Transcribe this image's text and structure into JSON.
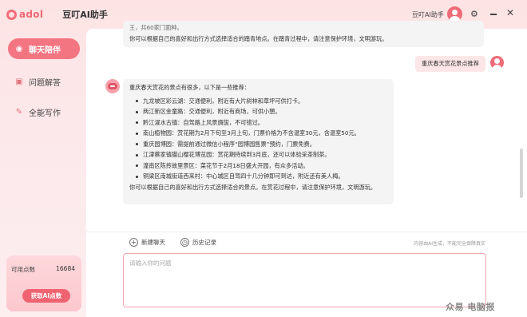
{
  "header": {
    "logo_text": "adol",
    "app_title": "豆叮AI助手",
    "user_name": "豆叮AI助手"
  },
  "sidebar": {
    "items": [
      {
        "label": "聊天陪伴",
        "icon": "chat-bubble-icon",
        "active": true
      },
      {
        "label": "问题解答",
        "icon": "question-box-icon",
        "active": false
      },
      {
        "label": "全能写作",
        "icon": "pencil-icon",
        "active": false
      }
    ],
    "points": {
      "label": "可用点数",
      "value": "16684",
      "button_label": "获取AI点数"
    }
  },
  "chat": {
    "previous_bot": {
      "truncated_text": "王，共60家门面种。",
      "closing": "你可以根据自己的喜好和出行方式选择适合的踏青地点。在踏青过程中，请注意保护环境，文明游玩。"
    },
    "user_message": "重庆春天赏花景点推荐",
    "bot_reply": {
      "intro": "重庆春天赏花的景点有很多，以下是一些推荐：",
      "items": [
        "九龙坡区彩云湖：交通便利，附近有大片树林和草坪可供打卡。",
        "两江新区金童路：交通便利，附近有商场，可供小憩。",
        "黔江濯水古镇：自驾路上风景旖旎，不可错过。",
        "南山植物园：赏花期为2月下旬至3月上旬，门票价格为不含温室30元，含温室50元。",
        "重庆园博园：需提前通过微信小程序“园博园售票”预约，门票免费。",
        "江津蔡家镇猫山樱花博览园：赏花期持续到3月底，还可以体验采茶制茶。",
        "潼南区陈抟故里景区：菜花节于2月18日盛大开园，有众多活动。",
        "铜梁区南城街道西来村：中心城区自驾四十几分钟即可到达，附近还有美人梅。"
      ],
      "closing": "你可以根据自己的喜好和出行方式选择适合的景点。在赏花过程中，请注意保护环境，文明游玩。"
    }
  },
  "toolbar": {
    "new_chat_label": "新建聊天",
    "history_label": "历史记录",
    "disclaimer": "内容由AI生成，不能完全保障真实"
  },
  "input": {
    "placeholder": "请输入你的问题",
    "value": ""
  },
  "watermark": "众易 电脑报",
  "colors": {
    "accent": "#f37581",
    "bubble_user": "#fde6e7",
    "bubble_bot": "#f4f4f4",
    "background": "#fde3e4"
  }
}
